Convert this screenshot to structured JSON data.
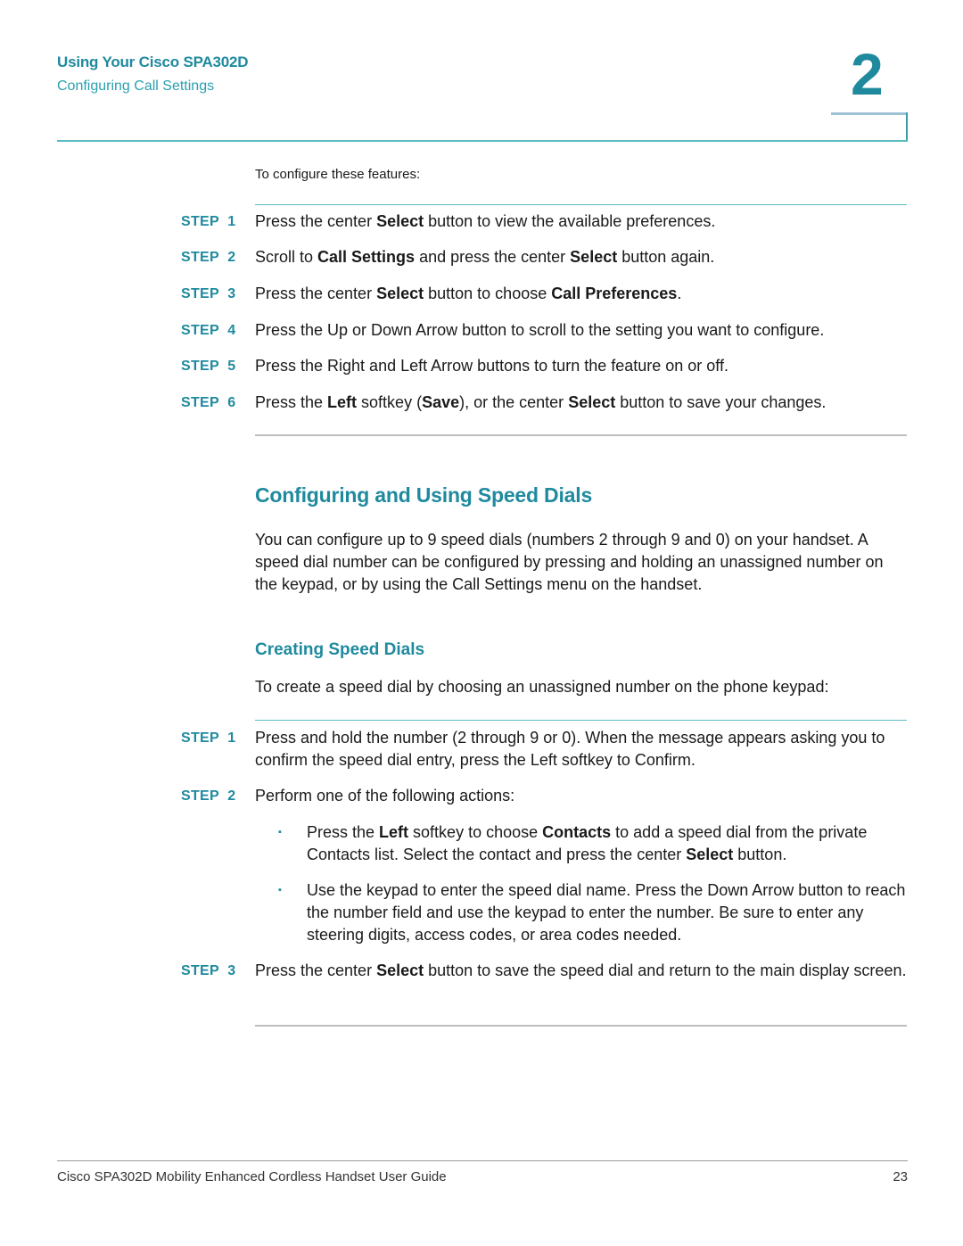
{
  "header": {
    "chapter_title": "Using Your Cisco SPA302D",
    "section": "Configuring Call Settings",
    "chapter_number": "2"
  },
  "configure": {
    "intro": "To configure these features:",
    "steps": [
      {
        "label": "STEP  1",
        "parts": [
          [
            "Press the center ",
            false
          ],
          [
            "Select",
            true
          ],
          [
            " button to view the available preferences.",
            false
          ]
        ]
      },
      {
        "label": "STEP  2",
        "parts": [
          [
            "Scroll to ",
            false
          ],
          [
            "Call Settings",
            true
          ],
          [
            " and press the center ",
            false
          ],
          [
            "Select",
            true
          ],
          [
            " button again.",
            false
          ]
        ]
      },
      {
        "label": "STEP  3",
        "parts": [
          [
            "Press the center ",
            false
          ],
          [
            "Select",
            true
          ],
          [
            " button to choose ",
            false
          ],
          [
            "Call Preferences",
            true
          ],
          [
            ".",
            false
          ]
        ]
      },
      {
        "label": "STEP  4",
        "parts": [
          [
            "Press the Up or Down Arrow button to scroll to the setting you want to configure.",
            false
          ]
        ]
      },
      {
        "label": "STEP  5",
        "parts": [
          [
            "Press the Right and Left Arrow buttons to turn the feature on or off.",
            false
          ]
        ]
      },
      {
        "label": "STEP  6",
        "parts": [
          [
            "Press the ",
            false
          ],
          [
            "Left",
            true
          ],
          [
            " softkey (",
            false
          ],
          [
            "Save",
            true
          ],
          [
            "), or the center ",
            false
          ],
          [
            "Select",
            true
          ],
          [
            " button to save your changes.",
            false
          ]
        ]
      }
    ]
  },
  "speed_dials": {
    "title": "Configuring and Using Speed Dials",
    "paragraph": "You can configure up to 9 speed dials (numbers 2 through 9 and 0) on your handset. A speed dial number can be configured by pressing and holding an unassigned number on the keypad, or by using the Call Settings menu on the handset.",
    "creating": {
      "title": "Creating Speed Dials",
      "intro": "To create a speed dial by choosing an unassigned number on the phone keypad:",
      "steps": [
        {
          "label": "STEP  1",
          "parts": [
            [
              "Press and hold the number (2 through 9 or 0). When the message appears asking you to confirm the speed dial entry, press the Left softkey to Confirm.",
              false
            ]
          ]
        },
        {
          "label": "STEP  2",
          "parts": [
            [
              "Perform one of the following actions:",
              false
            ]
          ]
        },
        {
          "label": "STEP  3",
          "parts": [
            [
              "Press the center ",
              false
            ],
            [
              "Select",
              true
            ],
            [
              " button to save the speed dial and return to the main display screen.",
              false
            ]
          ]
        }
      ],
      "bullets": [
        {
          "parts": [
            [
              "Press the ",
              false
            ],
            [
              "Left",
              true
            ],
            [
              " softkey to choose ",
              false
            ],
            [
              "Contacts",
              true
            ],
            [
              " to add a speed dial from the private Contacts list. Select the contact and press the center ",
              false
            ],
            [
              "Select",
              true
            ],
            [
              " button.",
              false
            ]
          ]
        },
        {
          "parts": [
            [
              "Use the keypad to enter the speed dial name. Press the Down Arrow button to reach the number field and use the keypad to enter the number. Be sure to enter any steering digits, access codes, or area codes needed.",
              false
            ]
          ]
        }
      ],
      "bullet_glyph": "▪"
    }
  },
  "footer": {
    "guide_title": "Cisco SPA302D Mobility Enhanced Cordless Handset User Guide",
    "page_number": "23"
  }
}
